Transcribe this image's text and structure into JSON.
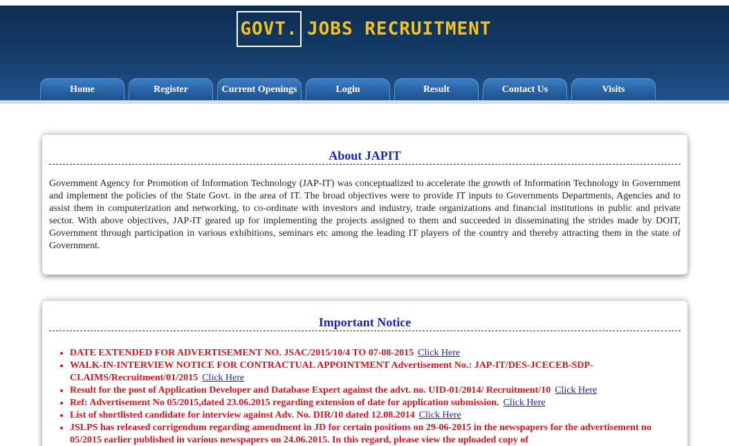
{
  "header": {
    "logo_box_text": "GOVT.",
    "logo_text": "JOBS RECRUITMENT",
    "colors": {
      "header_dark": "#0d2c50",
      "logo_yellow": "#f6c21a",
      "tab_blue": "#2a65a8"
    }
  },
  "nav": {
    "items": [
      {
        "label": "Home"
      },
      {
        "label": "Register"
      },
      {
        "label": "Current Openings"
      },
      {
        "label": "Login"
      },
      {
        "label": "Result"
      },
      {
        "label": "Contact Us"
      },
      {
        "label": "Visits"
      }
    ]
  },
  "about": {
    "title": "About JAPIT",
    "body": "Government Agency for Promotion of Information Technology (JAP-IT) was conceptualized to accelerate the growth of Information Technology in Government and implement the policies of the State Govt. in the area of IT. The broad objectives were to provide IT inputs to Governments Departments, Agencies and to assist them in computerization and networking, to co-ordinate with investors and industry, trade organizations and financial institutions in public and private sector. With above objectives, JAP-IT geared up for implementing the projects assigned to them and succeeded in disseminating the strides made by DOIT, Government through participation in various exhibitions, seminars etc among the leading IT players of the country and thereby attracting them in the state of Government."
  },
  "notice": {
    "title": "Important Notice",
    "items": [
      {
        "text": "DATE EXTENDED FOR ADVERTISEMENT NO. JSAC/2015/10/4 TO 07-08-2015",
        "link": "Click Here"
      },
      {
        "text": "WALK-IN-INTERVIEW NOTICE FOR CONTRACTUAL APPOINTMENT Advertisement No.: JAP-IT/DES-JCECEB-SDP-CLAIMS/Recruitment/01/2015",
        "link": "Click Here"
      },
      {
        "text": "Result for the post of Application Developer and Database Expert against the advt. no. UID-01/2014/ Recruitment/10",
        "link": "Click Here"
      },
      {
        "text": "Ref: Advertisement No 05/2015,dated 23.06.2015 regarding extension of date for application submission.",
        "link": "Click Here"
      },
      {
        "text": "List of shortlisted candidate for interview against Adv. No. DIR/10 dated 12.08.2014",
        "link": "Click Here"
      },
      {
        "text": "JSLPS has released corrigendum regarding amendment in JD for certain positions on 29-06-2015 in the newspapers for the advertisement no 05/2015 earlier published in various newspapers on 24.06.2015. In this regard, please view the uploaded copy of",
        "link": ""
      }
    ]
  }
}
